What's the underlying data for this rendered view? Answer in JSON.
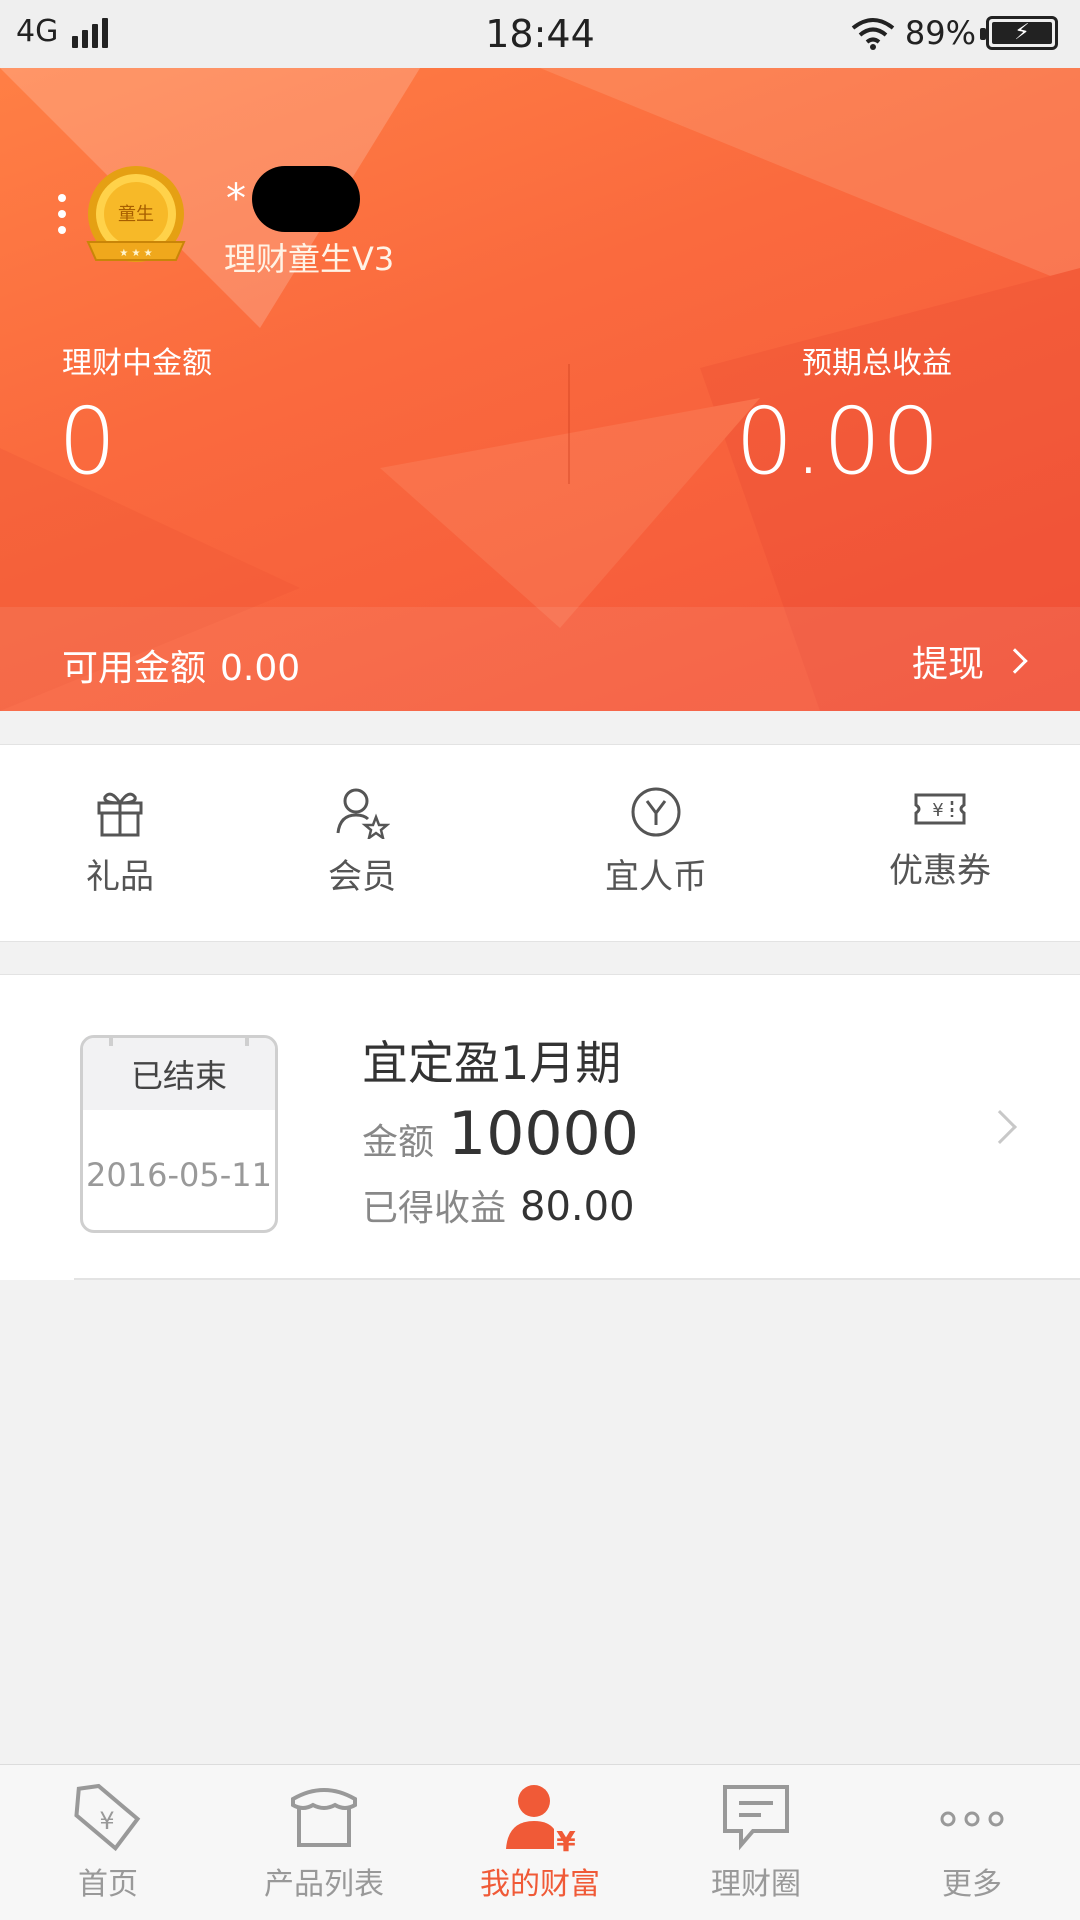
{
  "status_bar": {
    "network": "4G",
    "time": "18:44",
    "battery": "89%"
  },
  "profile": {
    "medal_text": "童生",
    "name_prefix": "*",
    "level": "理财童生V3"
  },
  "summary": {
    "investing_label": "理财中金额",
    "investing_value": "0",
    "expected_label": "预期总收益",
    "expected_value": "0.00",
    "available_label": "可用金额",
    "available_value": "0.00",
    "withdraw_label": "提现"
  },
  "actions": [
    {
      "label": "礼品",
      "icon": "gift-icon"
    },
    {
      "label": "会员",
      "icon": "member-icon"
    },
    {
      "label": "宜人币",
      "icon": "yiren-coin-icon"
    },
    {
      "label": "优惠券",
      "icon": "coupon-icon"
    }
  ],
  "product": {
    "status": "已结束",
    "date": "2016-05-11",
    "title": "宜定盈1月期",
    "amount_label": "金额",
    "amount_value": "10000",
    "earned_label": "已得收益",
    "earned_value": "80.00"
  },
  "bottom_nav": {
    "items": [
      {
        "label": "首页",
        "icon": "home-tag-icon"
      },
      {
        "label": "产品列表",
        "icon": "store-icon"
      },
      {
        "label": "我的财富",
        "icon": "my-wealth-icon"
      },
      {
        "label": "理财圈",
        "icon": "chat-icon"
      },
      {
        "label": "更多",
        "icon": "more-dots-icon"
      }
    ],
    "active_index": 2
  },
  "colors": {
    "accent": "#f05a37",
    "hero_start": "#ff7f45",
    "hero_end": "#f4553a"
  }
}
